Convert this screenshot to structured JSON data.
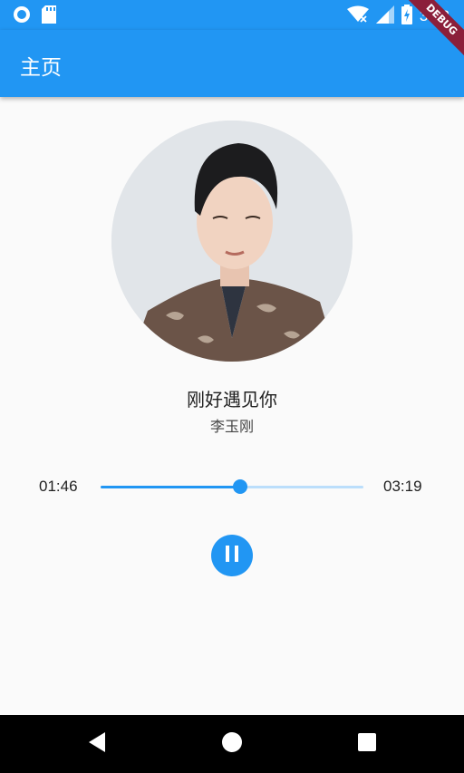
{
  "status_bar": {
    "time": "3:42",
    "icons": [
      "radio-icon",
      "sd-card-icon",
      "wifi-icon",
      "signal-icon",
      "battery-charging-icon"
    ]
  },
  "app_bar": {
    "title": "主页",
    "background": "#2196f3"
  },
  "debug_banner": "DEBUG",
  "player": {
    "song_title": "刚好遇见你",
    "artist": "李玉刚",
    "current_time": "01:46",
    "total_time": "03:19",
    "progress": 0.532,
    "playing": true,
    "control_icon": "pause-icon"
  },
  "nav_bar": {
    "icons": [
      "back-icon",
      "home-icon",
      "recents-icon"
    ]
  },
  "colors": {
    "accent": "#2196f3",
    "track": "#bbdefb",
    "debug": "#8b1f3a"
  }
}
